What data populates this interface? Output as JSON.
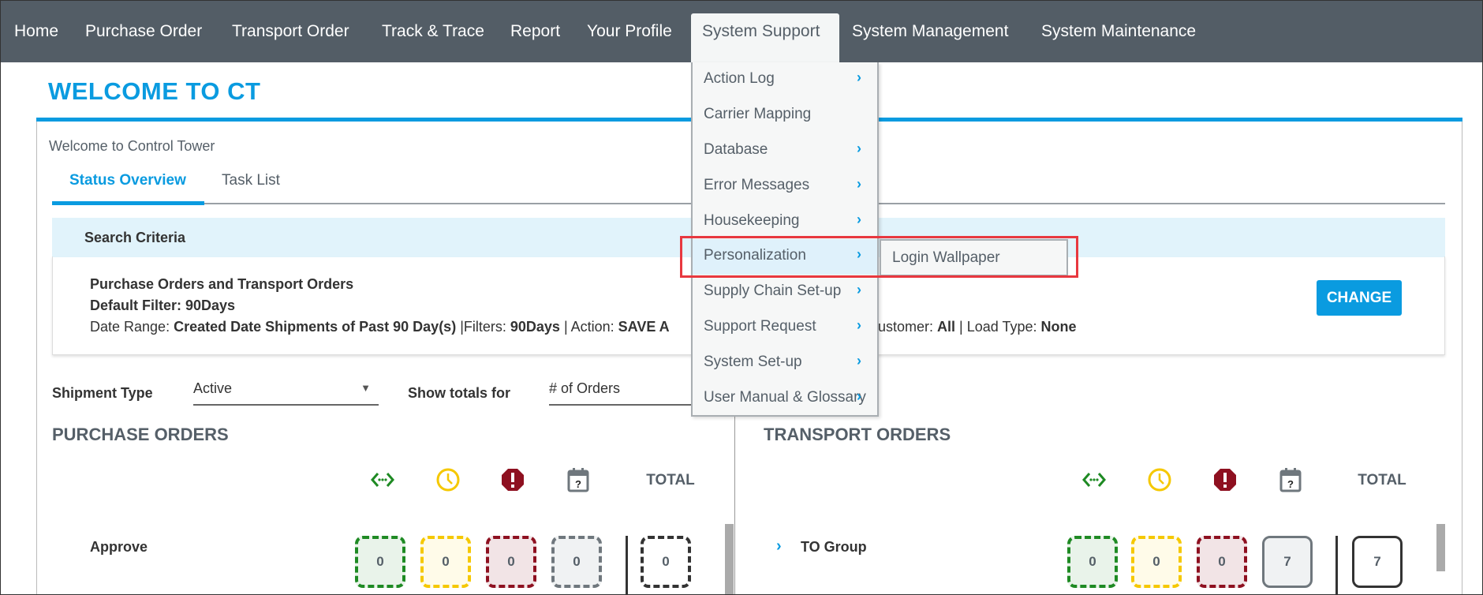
{
  "nav": {
    "items": [
      "Home",
      "Purchase Order",
      "Transport Order",
      "Track & Trace",
      "Report",
      "Your Profile",
      "System Support",
      "System Management",
      "System Maintenance"
    ],
    "active": "System Support"
  },
  "page": {
    "title": "WELCOME TO CT",
    "subtitle": "Welcome to Control Tower",
    "tabs": [
      "Status Overview",
      "Task List"
    ],
    "active_tab": "Status Overview"
  },
  "search_criteria": {
    "label": "Search Criteria",
    "line1": "Purchase Orders and Transport Orders",
    "line2": "Default Filter: 90Days",
    "date_range_label": "Date Range: ",
    "date_range_value": "Created Date Shipments of Past 90 Day(s)",
    "filters_label": " |Filters: ",
    "filters_value": "90Days",
    "action_label": " | Action: ",
    "action_value": "SAVE A",
    "customer_label": "ustomer: ",
    "customer_value": "All",
    "load_type_label": " | Load Type: ",
    "load_type_value": "None",
    "change_button": "CHANGE"
  },
  "filters": {
    "shipment_type_label": "Shipment Type",
    "shipment_type_value": "Active",
    "show_totals_label": "Show totals for",
    "show_totals_value": "# of Orders"
  },
  "purchase_orders": {
    "title": "PURCHASE ORDERS",
    "total_header": "TOTAL",
    "rows": [
      {
        "label": "Approve",
        "counts": [
          "0",
          "0",
          "0",
          "0"
        ],
        "total": "0"
      }
    ]
  },
  "transport_orders": {
    "title": "TRANSPORT ORDERS",
    "total_header": "TOTAL",
    "rows": [
      {
        "label": "TO Group",
        "counts": [
          "0",
          "0",
          "0",
          "7"
        ],
        "total": "7"
      }
    ]
  },
  "status_icons": [
    "in-transit-icon",
    "clock-icon",
    "alert-octagon-icon",
    "calendar-question-icon"
  ],
  "colors": {
    "accent": "#0a9be0",
    "nav_bg": "#535d66",
    "green": "#1e8a23",
    "yellow": "#f5c800",
    "red": "#8e1020",
    "grey": "#6f777d",
    "highlight": "#e8383f"
  },
  "menu": {
    "items": [
      {
        "label": "Action Log",
        "submenu": true
      },
      {
        "label": "Carrier Mapping",
        "submenu": false
      },
      {
        "label": "Database",
        "submenu": true
      },
      {
        "label": "Error Messages",
        "submenu": true
      },
      {
        "label": "Housekeeping",
        "submenu": true
      },
      {
        "label": "Personalization",
        "submenu": true
      },
      {
        "label": "Supply Chain Set-up",
        "submenu": true
      },
      {
        "label": "Support Request",
        "submenu": true
      },
      {
        "label": "System Set-up",
        "submenu": true
      },
      {
        "label": "User Manual & Glossary",
        "submenu": true
      }
    ],
    "highlighted": "Personalization",
    "submenu_items": [
      "Login Wallpaper"
    ]
  }
}
